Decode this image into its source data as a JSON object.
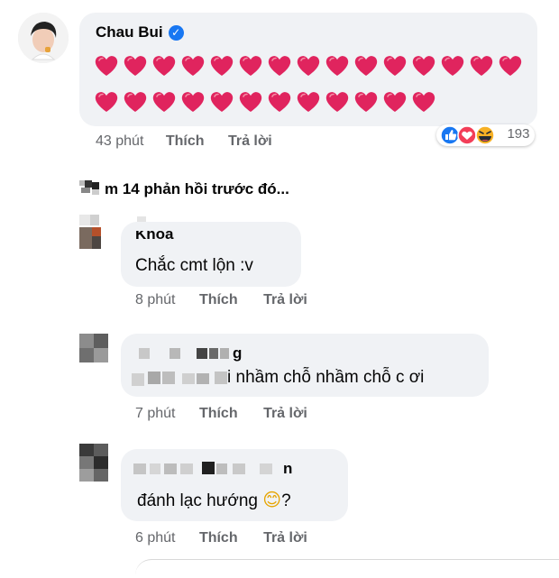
{
  "main_comment": {
    "author": "Chau Bui",
    "heart_rows": [
      15,
      12
    ],
    "time": "43 phút",
    "like_label": "Thích",
    "reply_label": "Trả lời",
    "reaction_icons": [
      "like-icon",
      "love-icon",
      "haha-icon"
    ],
    "reaction_count": "193"
  },
  "more_replies": "m 14 phản hồi trước đó...",
  "replies": [
    {
      "author": "Khoa",
      "text": "Chắc cmt lộn :v",
      "time": "8 phút",
      "like_label": "Thích",
      "reply_label": "Trả lời"
    },
    {
      "author": "g",
      "text": "i nhầm chỗ nhầm chỗ c ơi",
      "time": "7 phút",
      "like_label": "Thích",
      "reply_label": "Trả lời"
    },
    {
      "author": "n",
      "text": "đánh lạc hướng",
      "emoji": "😊",
      "text_after": "?",
      "time": "6 phút",
      "like_label": "Thích",
      "reply_label": "Trả lời"
    }
  ],
  "colors": {
    "bubble": "#f0f2f5",
    "heart": "#e0245e",
    "verified": "#1877f2",
    "meta": "#65676b"
  }
}
